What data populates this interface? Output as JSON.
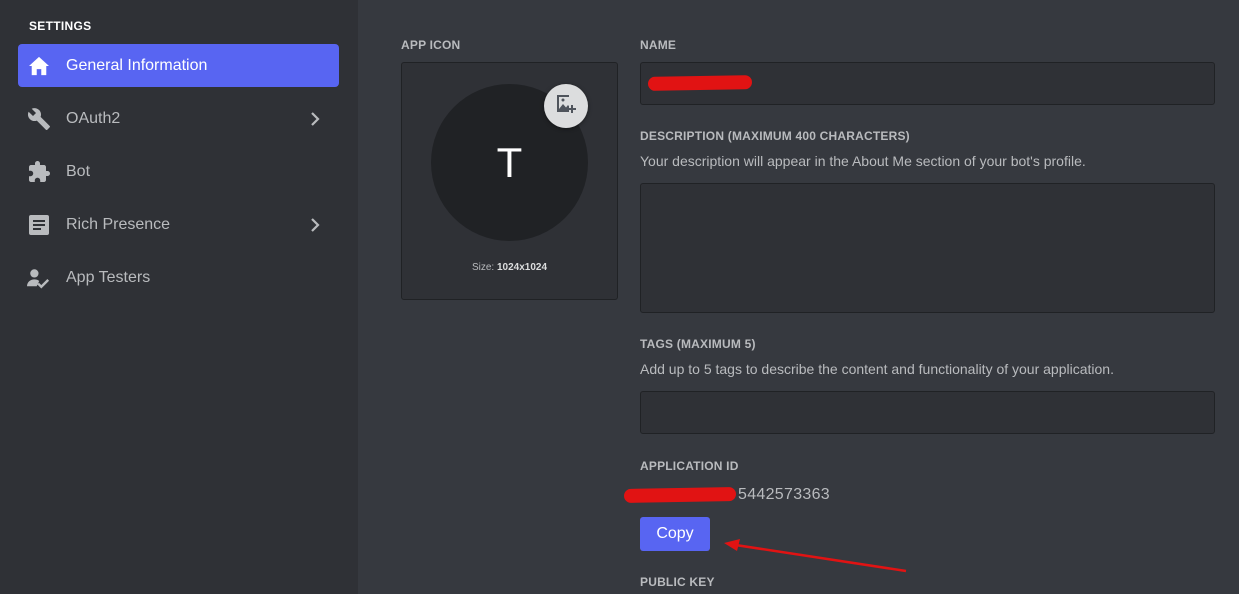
{
  "sidebar": {
    "heading": "SETTINGS",
    "items": [
      {
        "label": "General Information",
        "icon": "home-icon",
        "active": true,
        "has_chevron": false
      },
      {
        "label": "OAuth2",
        "icon": "wrench-icon",
        "active": false,
        "has_chevron": true
      },
      {
        "label": "Bot",
        "icon": "puzzle-icon",
        "active": false,
        "has_chevron": false
      },
      {
        "label": "Rich Presence",
        "icon": "document-icon",
        "active": false,
        "has_chevron": true
      },
      {
        "label": "App Testers",
        "icon": "person-check-icon",
        "active": false,
        "has_chevron": false
      }
    ]
  },
  "app_icon": {
    "label": "APP ICON",
    "initial": "T",
    "size_prefix": "Size: ",
    "size_value": "1024x1024"
  },
  "name": {
    "label": "NAME",
    "value": ""
  },
  "description": {
    "label": "DESCRIPTION (MAXIMUM 400 CHARACTERS)",
    "help": "Your description will appear in the About Me section of your bot's profile.",
    "value": ""
  },
  "tags": {
    "label": "TAGS (MAXIMUM 5)",
    "help": "Add up to 5 tags to describe the content and functionality of your application.",
    "value": ""
  },
  "application_id": {
    "label": "APPLICATION ID",
    "visible_value": "5442573363",
    "copy_label": "Copy"
  },
  "public_key": {
    "label": "PUBLIC KEY"
  },
  "colors": {
    "accent": "#5865f2",
    "sidebar_bg": "#2f3136",
    "main_bg": "#36393f",
    "annotation": "#e11313"
  }
}
